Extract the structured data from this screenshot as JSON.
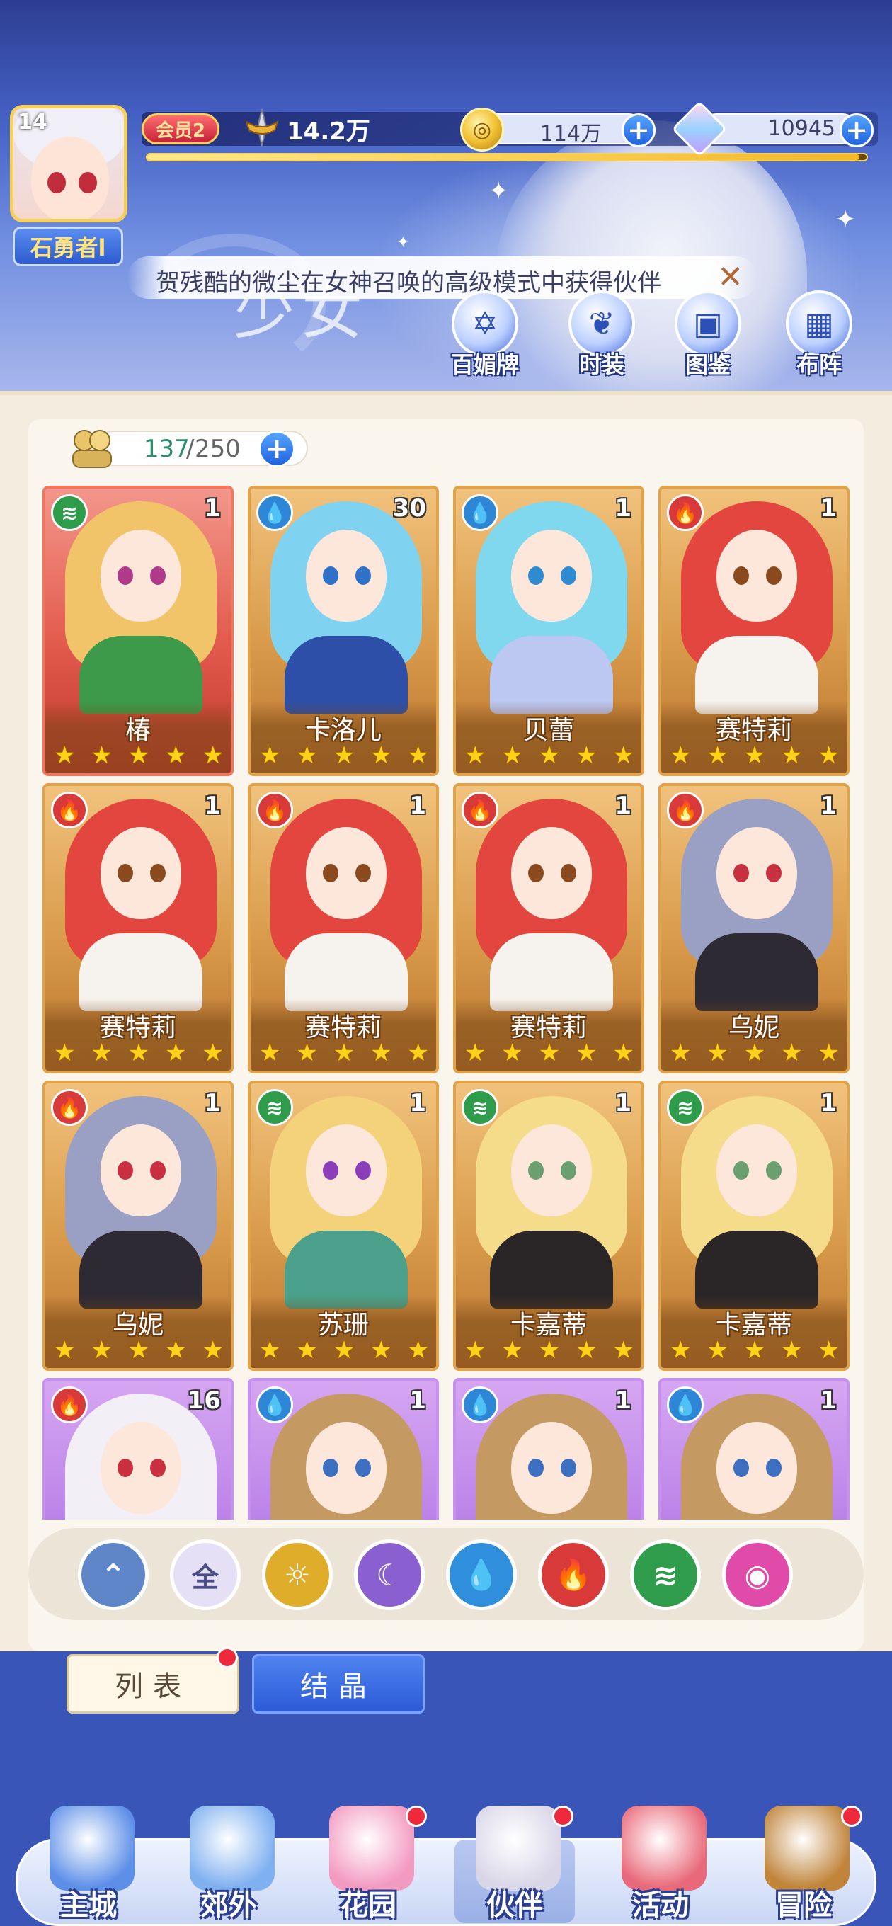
{
  "player": {
    "level": "14",
    "name": "石勇者l",
    "vip_label": "会员2",
    "power": "14.2万",
    "exp_progress": 0.99
  },
  "resources": {
    "gold": "114万",
    "gems": "10945"
  },
  "marquee": {
    "text": "贺残酷的微尘在女神召唤的高级模式中获得伙伴"
  },
  "hero_title": "少女",
  "quick_buttons": [
    {
      "label": "百媚牌",
      "icon": "emblem-icon"
    },
    {
      "label": "时装",
      "icon": "outfit-icon"
    },
    {
      "label": "图鉴",
      "icon": "book-icon"
    },
    {
      "label": "布阵",
      "icon": "formation-grid-icon"
    }
  ],
  "roster": {
    "current": "137",
    "sep": "/",
    "max": "250"
  },
  "cards": [
    {
      "name": "椿",
      "level": "1",
      "element": "wind",
      "rarity": "red",
      "stars": 5,
      "hair": "#f1c46a",
      "eye": "#b03a8a",
      "outfit": "#3d9a4a"
    },
    {
      "name": "卡洛儿",
      "level": "30",
      "element": "water",
      "rarity": "gold",
      "stars": 5,
      "hair": "#7fd3f0",
      "eye": "#2f70c8",
      "outfit": "#2d4fa8"
    },
    {
      "name": "贝蕾",
      "level": "1",
      "element": "water",
      "rarity": "gold",
      "stars": 5,
      "hair": "#7fd8ee",
      "eye": "#2e8bcf",
      "outfit": "#bcc7f2"
    },
    {
      "name": "赛特莉",
      "level": "1",
      "element": "fire",
      "rarity": "gold",
      "stars": 5,
      "hair": "#e2463e",
      "eye": "#8a4a1e",
      "outfit": "#f6f2ee"
    },
    {
      "name": "赛特莉",
      "level": "1",
      "element": "fire",
      "rarity": "gold",
      "stars": 5,
      "hair": "#e2463e",
      "eye": "#8a4a1e",
      "outfit": "#f6f2ee"
    },
    {
      "name": "赛特莉",
      "level": "1",
      "element": "fire",
      "rarity": "gold",
      "stars": 5,
      "hair": "#e2463e",
      "eye": "#8a4a1e",
      "outfit": "#f6f2ee"
    },
    {
      "name": "赛特莉",
      "level": "1",
      "element": "fire",
      "rarity": "gold",
      "stars": 5,
      "hair": "#e2463e",
      "eye": "#8a4a1e",
      "outfit": "#f6f2ee"
    },
    {
      "name": "乌妮",
      "level": "1",
      "element": "fire",
      "rarity": "gold",
      "stars": 5,
      "hair": "#9aa0c4",
      "eye": "#c83040",
      "outfit": "#2e2a34"
    },
    {
      "name": "乌妮",
      "level": "1",
      "element": "fire",
      "rarity": "gold",
      "stars": 5,
      "hair": "#9aa0c4",
      "eye": "#c83040",
      "outfit": "#2e2a34"
    },
    {
      "name": "苏珊",
      "level": "1",
      "element": "wind",
      "rarity": "gold",
      "stars": 5,
      "hair": "#f3d27a",
      "eye": "#8a3fb8",
      "outfit": "#4aa08a"
    },
    {
      "name": "卡嘉蒂",
      "level": "1",
      "element": "wind",
      "rarity": "gold",
      "stars": 5,
      "hair": "#f4dc8a",
      "eye": "#6aa070",
      "outfit": "#2a2628"
    },
    {
      "name": "卡嘉蒂",
      "level": "1",
      "element": "wind",
      "rarity": "gold",
      "stars": 5,
      "hair": "#f4dc8a",
      "eye": "#6aa070",
      "outfit": "#2a2628"
    },
    {
      "name": "",
      "level": "16",
      "element": "fire",
      "rarity": "purple",
      "stars": 5,
      "hair": "#f2f0f6",
      "eye": "#c83040",
      "outfit": "#d63b3b"
    },
    {
      "name": "",
      "level": "1",
      "element": "water",
      "rarity": "purple",
      "stars": 5,
      "hair": "#c59a62",
      "eye": "#3c6fbf",
      "outfit": "#e8e0d2"
    },
    {
      "name": "",
      "level": "1",
      "element": "water",
      "rarity": "purple",
      "stars": 5,
      "hair": "#c59a62",
      "eye": "#3c6fbf",
      "outfit": "#e8e0d2"
    },
    {
      "name": "",
      "level": "1",
      "element": "water",
      "rarity": "purple",
      "stars": 5,
      "hair": "#c59a62",
      "eye": "#3c6fbf",
      "outfit": "#e8e0d2"
    }
  ],
  "element_colors": {
    "wind": "#2f9c4c",
    "water": "#2e86d6",
    "fire": "#d83a3a"
  },
  "filters": [
    {
      "name": "filter-light",
      "glyph": "",
      "color": "#5f86c9",
      "icon": "light-wing-icon"
    },
    {
      "name": "filter-all",
      "glyph": "全",
      "color": "#e6e0f6",
      "icon": "all-icon"
    },
    {
      "name": "filter-sun",
      "glyph": "☼",
      "color": "#e0ad2a",
      "icon": "sun-icon"
    },
    {
      "name": "filter-moon",
      "glyph": "☾",
      "color": "#8a5fd0",
      "icon": "moon-icon"
    },
    {
      "name": "filter-water",
      "glyph": "💧",
      "color": "#2f8fdc",
      "icon": "water-drop-icon"
    },
    {
      "name": "filter-fire",
      "glyph": "🔥",
      "color": "#d83a3a",
      "icon": "fire-icon"
    },
    {
      "name": "filter-wind",
      "glyph": "≋",
      "color": "#2f9c4c",
      "icon": "wind-icon"
    },
    {
      "name": "filter-charm",
      "glyph": "◉",
      "color": "#e04aa8",
      "icon": "charm-icon"
    }
  ],
  "subtabs": {
    "list": "列表",
    "crystal": "结晶"
  },
  "nav": [
    {
      "label": "主城",
      "key": "main-city",
      "art": "#5d8fe8",
      "badge": false
    },
    {
      "label": "郊外",
      "key": "outskirts",
      "art": "#7fb0f0",
      "badge": false
    },
    {
      "label": "花园",
      "key": "garden",
      "art": "#f39ac0",
      "badge": true
    },
    {
      "label": "伙伴",
      "key": "partners",
      "art": "#d9d6e8",
      "badge": true,
      "active": true
    },
    {
      "label": "活动",
      "key": "events",
      "art": "#e86a7a",
      "badge": false
    },
    {
      "label": "冒险",
      "key": "adventure",
      "art": "#c0843a",
      "badge": true
    }
  ]
}
